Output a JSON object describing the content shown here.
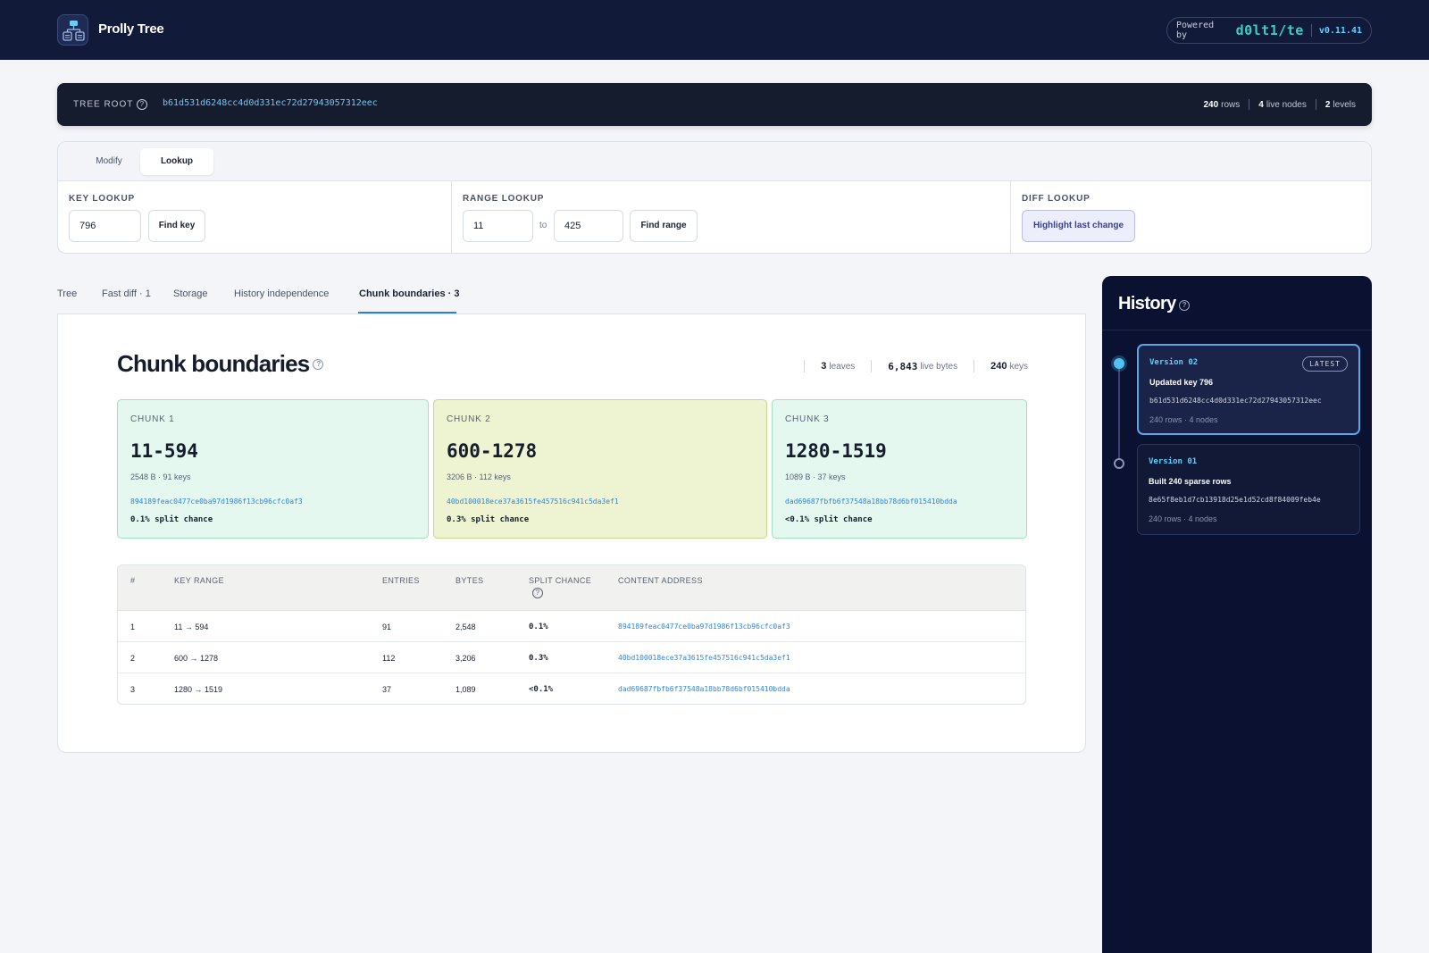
{
  "app": {
    "title": "Prolly Tree",
    "powered_label": "Powered by",
    "brand": "d0lt1/te",
    "version": "v0.11.41"
  },
  "root": {
    "label": "TREE ROOT",
    "hash": "b61d531d6248cc4d0d331ec72d27943057312eec",
    "rows_value": "240",
    "rows_label": "rows",
    "nodes_value": "4",
    "nodes_label": "live nodes",
    "levels_value": "2",
    "levels_label": "levels"
  },
  "controls": {
    "tabs": [
      {
        "label": "Modify"
      },
      {
        "label": "Lookup"
      }
    ],
    "active_tab": "Lookup",
    "key_lookup": {
      "title": "KEY LOOKUP",
      "value": "796",
      "button": "Find key"
    },
    "range_lookup": {
      "title": "RANGE LOOKUP",
      "from": "11",
      "to_label": "to",
      "to": "425",
      "button": "Find range"
    },
    "diff_lookup": {
      "title": "DIFF LOOKUP",
      "button": "Highlight last change"
    }
  },
  "main_tabs": [
    {
      "label": "Tree"
    },
    {
      "label": "Fast diff · 1"
    },
    {
      "label": "Storage"
    },
    {
      "label": "History independence"
    },
    {
      "label": "Chunk boundaries · 3"
    }
  ],
  "active_main_tab": "Chunk boundaries · 3",
  "chunk_boundaries": {
    "title": "Chunk boundaries",
    "stats": {
      "leaves_value": "3",
      "leaves_label": "leaves",
      "bytes_value": "6,843",
      "bytes_label": "live bytes",
      "keys_value": "240",
      "keys_label": "keys"
    },
    "chunks": [
      {
        "label": "CHUNK 1",
        "range": "11-594",
        "meta": "2548 B · 91 keys",
        "hash": "894189feac0477ce0ba97d1986f13cb96cfc0af3",
        "split": "0.1% split chance",
        "bg": "#e4f8ef",
        "border": "#9ee0bf"
      },
      {
        "label": "CHUNK 2",
        "range": "600-1278",
        "meta": "3206 B · 112 keys",
        "hash": "40bd100018ece37a3615fe457516c941c5da3ef1",
        "split": "0.3% split chance",
        "bg": "#eef4d2",
        "border": "#c6d58a"
      },
      {
        "label": "CHUNK 3",
        "range": "1280-1519",
        "meta": "1089 B · 37 keys",
        "hash": "dad69687fbfb6f37548a18bb78d6bf015410bdda",
        "split": "<0.1% split chance",
        "bg": "#e4f8ef",
        "border": "#9ee0bf"
      }
    ],
    "table": {
      "headers": {
        "num": "#",
        "range": "KEY RANGE",
        "entries": "ENTRIES",
        "bytes": "BYTES",
        "split": "SPLIT CHANCE",
        "address": "CONTENT ADDRESS"
      },
      "rows": [
        {
          "num": "1",
          "range": "11 → 594",
          "entries": "91",
          "bytes": "2,548",
          "split": "0.1%",
          "address": "894189feac0477ce0ba97d1986f13cb96cfc0af3"
        },
        {
          "num": "2",
          "range": "600 → 1278",
          "entries": "112",
          "bytes": "3,206",
          "split": "0.3%",
          "address": "40bd100018ece37a3615fe457516c941c5da3ef1"
        },
        {
          "num": "3",
          "range": "1280 → 1519",
          "entries": "37",
          "bytes": "1,089",
          "split": "<0.1%",
          "address": "dad69687fbfb6f37548a18bb78d6bf015410bdda"
        }
      ]
    }
  },
  "history": {
    "title": "History",
    "versions": [
      {
        "name": "Version 02",
        "badge": "LATEST",
        "desc": "Updated key 796",
        "hash": "b61d531d6248cc4d0d331ec72d27943057312eec",
        "meta": "240 rows · 4 nodes"
      },
      {
        "name": "Version 01",
        "desc": "Built 240 sparse rows",
        "hash": "8e65f8eb1d7cb13918d25e1d52cd8f84009feb4e",
        "meta": "240 rows · 4 nodes"
      }
    ]
  }
}
